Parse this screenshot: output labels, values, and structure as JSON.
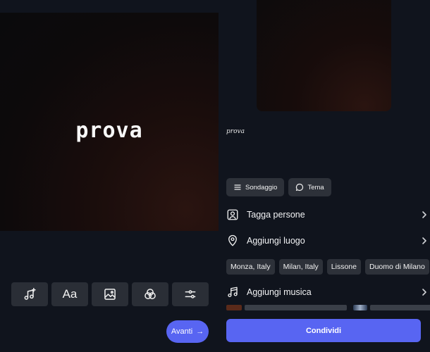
{
  "editor": {
    "canvas_text": "prova",
    "tools": [
      {
        "name": "add-music-icon"
      },
      {
        "name": "text-icon",
        "label": "Aa"
      },
      {
        "name": "image-icon"
      },
      {
        "name": "filters-icon"
      },
      {
        "name": "adjust-icon"
      }
    ],
    "next_label": "Avanti",
    "next_arrow": "→"
  },
  "post": {
    "caption": "prova",
    "chips": [
      {
        "label": "Sondaggio",
        "icon": "list-icon"
      },
      {
        "label": "Tema",
        "icon": "chat-bubble-icon"
      }
    ],
    "tag_people_label": "Tagga persone",
    "add_location_label": "Aggiungi luogo",
    "location_suggestions": [
      "Monza, Italy",
      "Milan, Italy",
      "Lissone",
      "Duomo di Milano"
    ],
    "add_music_label": "Aggiungi musica",
    "share_label": "Condividi"
  },
  "colors": {
    "accent": "#5865f2",
    "background": "#10141d",
    "chip_bg": "#2d3139"
  }
}
